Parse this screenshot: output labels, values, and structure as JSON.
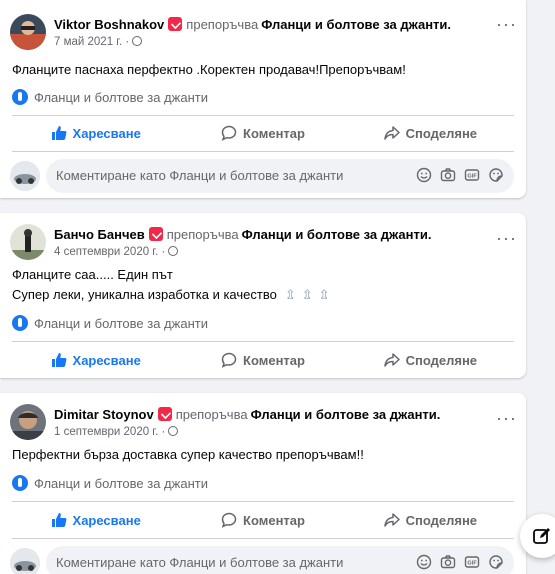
{
  "reviews": [
    {
      "author": "Viktor Boshnakov",
      "recommends": "препоръчва",
      "page": "Фланци и болтове за джанти.",
      "date": "7 май 2021 г. ·",
      "text_lines": [
        "Фланците паснаха перфектно .Коректен продавач!Препоръчвам!"
      ],
      "tag": "Фланци и болтове за джанти"
    },
    {
      "author": "Банчо Банчев",
      "recommends": "препоръчва",
      "page": "Фланци и болтове за джанти.",
      "date": "4 септември 2020 г. ·",
      "text_lines": [
        "Фланците саа..... Един път",
        "Супер леки, уникална изработка и качество"
      ],
      "tag": "Фланци и болтове за джанти"
    },
    {
      "author": "Dimitar Stoynov",
      "recommends": "препоръчва",
      "page": "Фланци и болтове за джанти.",
      "date": "1 септември 2020 г. ·",
      "text_lines": [
        "Перфектни бърза доставка супер качество препоръчвам!!"
      ],
      "tag": "Фланци и болтове за джанти"
    }
  ],
  "actions": {
    "like": "Харесване",
    "comment": "Коментар",
    "share": "Споделяне"
  },
  "comment_placeholder": "Коментиране като Фланци и болтове за джанти",
  "colors": {
    "accent": "#1877f2",
    "recommend_badge": "#f02849",
    "muted": "#65676b",
    "background": "#f0f2f5"
  }
}
